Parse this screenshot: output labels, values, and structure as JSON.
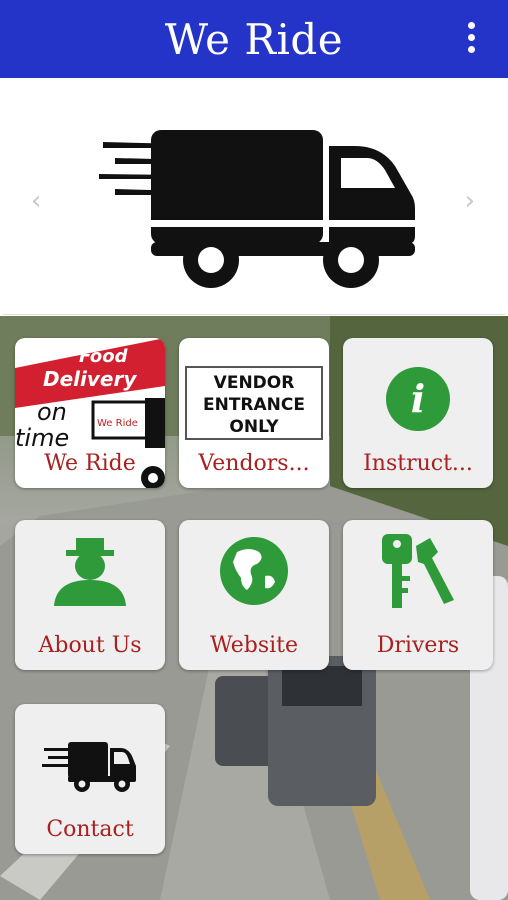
{
  "app": {
    "title": "We Ride",
    "menu_icon": "more-vert-icon",
    "bar_color": "#2434c8"
  },
  "banner": {
    "image": "delivery-truck-icon",
    "prev_icon": "chevron-left-icon",
    "next_icon": "chevron-right-icon"
  },
  "tiles": [
    {
      "label": "We Ride",
      "image": "food-delivery-image",
      "image_text": [
        "Food",
        "Delivery",
        "on",
        "time",
        "We Ride"
      ]
    },
    {
      "label": "Vendors...",
      "image": "vendor-entrance-sign",
      "image_text": [
        "VENDOR",
        "ENTRANCE",
        "ONLY"
      ]
    },
    {
      "label": "Instruct...",
      "image": "info-icon",
      "image_text": [
        "i"
      ]
    },
    {
      "label": "About Us",
      "image": "person-icon"
    },
    {
      "label": "Website",
      "image": "globe-icon"
    },
    {
      "label": "Drivers",
      "image": "keys-icon"
    },
    {
      "label": "Contact",
      "image": "delivery-truck-icon"
    }
  ],
  "colors": {
    "label": "#a82020",
    "icon_green": "#2e9a3a"
  }
}
